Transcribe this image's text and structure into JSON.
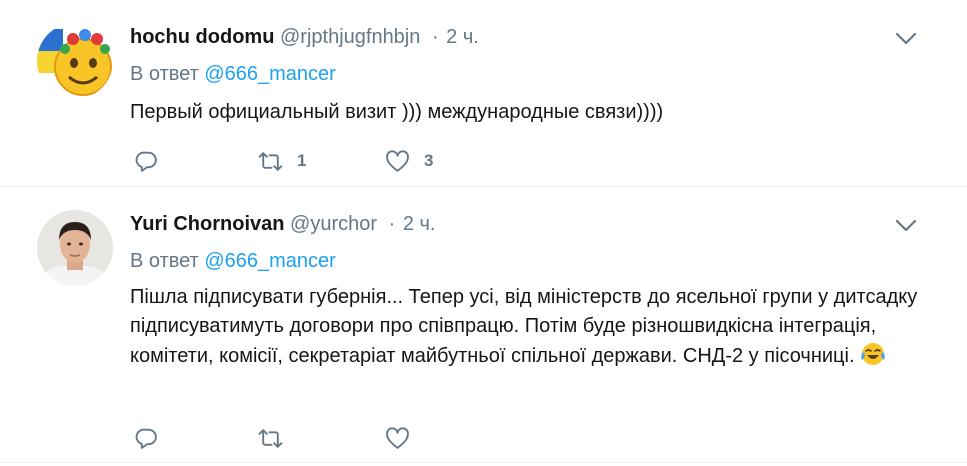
{
  "tweets": [
    {
      "name": "hochu dodomu",
      "handle": "@rjpthjugfnhbjn",
      "dot": "·",
      "time": "2 ч.",
      "reply_prefix": "В ответ",
      "reply_mention": "@666_mancer",
      "text": "Первый официальный визит ))) международные связи))))",
      "avatar_icon": "yellow-face-with-flag-avatar",
      "replies": "",
      "retweets": "1",
      "likes": "3"
    },
    {
      "name": "Yuri Chornoivan",
      "handle": "@yurchor",
      "dot": "·",
      "time": "2 ч.",
      "reply_prefix": "В ответ",
      "reply_mention": "@666_mancer",
      "text": "Пішла підписувати губернія... Тепер усі, від міністерств до ясельної групи у дитсадку підписуватимуть договори про співпрацю. Потім буде різношвидкісна інтеграція, комітети, комісії, секретаріат майбутньої спільної держави. СНД-2 у пісочниці.",
      "text_emoji": "face-with-tears-of-joy",
      "avatar_icon": "man-portrait-avatar",
      "replies": "",
      "retweets": "",
      "likes": ""
    }
  ],
  "colors": {
    "link": "#1da1f2",
    "muted": "#657786",
    "text": "#14171a",
    "divider": "#e6ecf0"
  }
}
